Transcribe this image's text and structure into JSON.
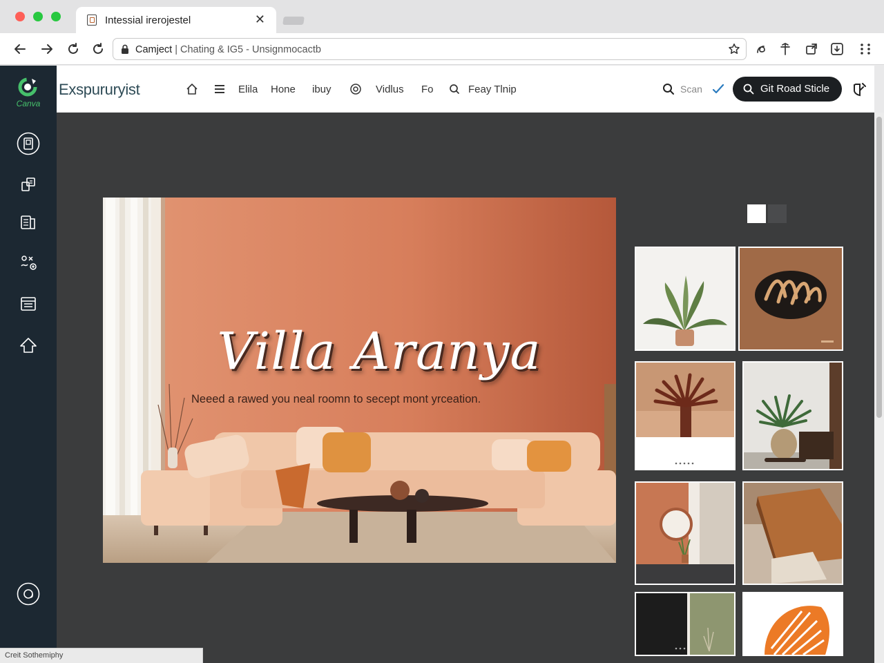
{
  "browser": {
    "tab_title": "Intessial irerojestel",
    "url_host": "Camject",
    "url_rest": "| Chating & IG5 - Unsignmocactb"
  },
  "sidebar": {
    "logo_text": "Canva"
  },
  "header": {
    "brand": "Exspururyist",
    "nav": [
      "Elila",
      "Hone",
      "ibuy",
      "Vidlus",
      "Fo",
      "Feay Tlnip"
    ],
    "search_label": "Scan",
    "cta_label": "Git Road Sticle"
  },
  "hero": {
    "title": "Villa Aranya",
    "subtitle": "Neeed a rawed you neal roomn to secept mont yrceation."
  },
  "status_bar": {
    "text": "Creit Sothemiphy"
  },
  "colors": {
    "sidebar": "#1c2832",
    "workspace": "#3b3c3d",
    "terracotta": "#d98664",
    "cta": "#1c1f22",
    "brand_green": "#46c06b"
  }
}
